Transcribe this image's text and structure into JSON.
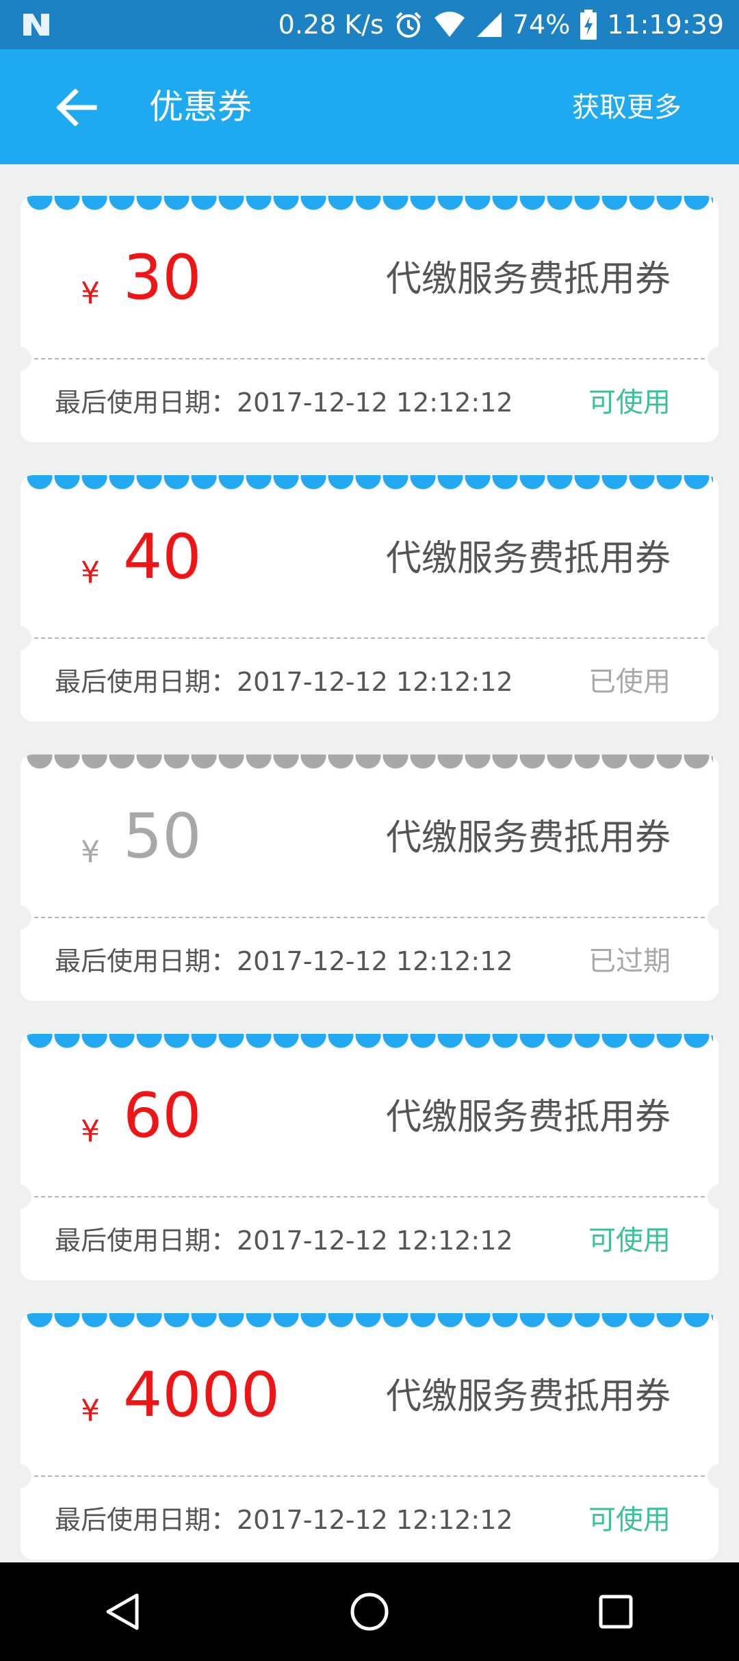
{
  "status_bar": {
    "speed": "0.28 K/s",
    "battery": "74%",
    "time": "11:19:39",
    "icons": [
      "notification-n-icon",
      "alarm-icon",
      "wifi-icon",
      "signal-icon",
      "battery-charging-icon"
    ]
  },
  "app_bar": {
    "back_icon": "arrow-left-icon",
    "title": "优惠券",
    "more_label": "获取更多"
  },
  "coupons": [
    {
      "currency": "¥",
      "amount": "30",
      "name": "代缴服务费抵用券",
      "expiry": "最后使用日期：2017-12-12 12:12:12",
      "status": "可使用",
      "state": "available"
    },
    {
      "currency": "¥",
      "amount": "40",
      "name": "代缴服务费抵用券",
      "expiry": "最后使用日期：2017-12-12 12:12:12",
      "status": "已使用",
      "state": "used"
    },
    {
      "currency": "¥",
      "amount": "50",
      "name": "代缴服务费抵用券",
      "expiry": "最后使用日期：2017-12-12 12:12:12",
      "status": "已过期",
      "state": "expired"
    },
    {
      "currency": "¥",
      "amount": "60",
      "name": "代缴服务费抵用券",
      "expiry": "最后使用日期：2017-12-12 12:12:12",
      "status": "可使用",
      "state": "available"
    },
    {
      "currency": "¥",
      "amount": "4000",
      "name": "代缴服务费抵用券",
      "expiry": "最后使用日期：2017-12-12 12:12:12",
      "status": "可使用",
      "state": "available"
    }
  ],
  "nav_bar": {
    "icons": [
      "back-triangle-icon",
      "home-circle-icon",
      "recents-square-icon"
    ]
  },
  "colors": {
    "status_bar": "#1c82c3",
    "app_bar": "#1eaaf1",
    "amount_red": "#f01414",
    "available_green": "#3cbf9b",
    "inactive_gray": "#a8a8a8"
  }
}
